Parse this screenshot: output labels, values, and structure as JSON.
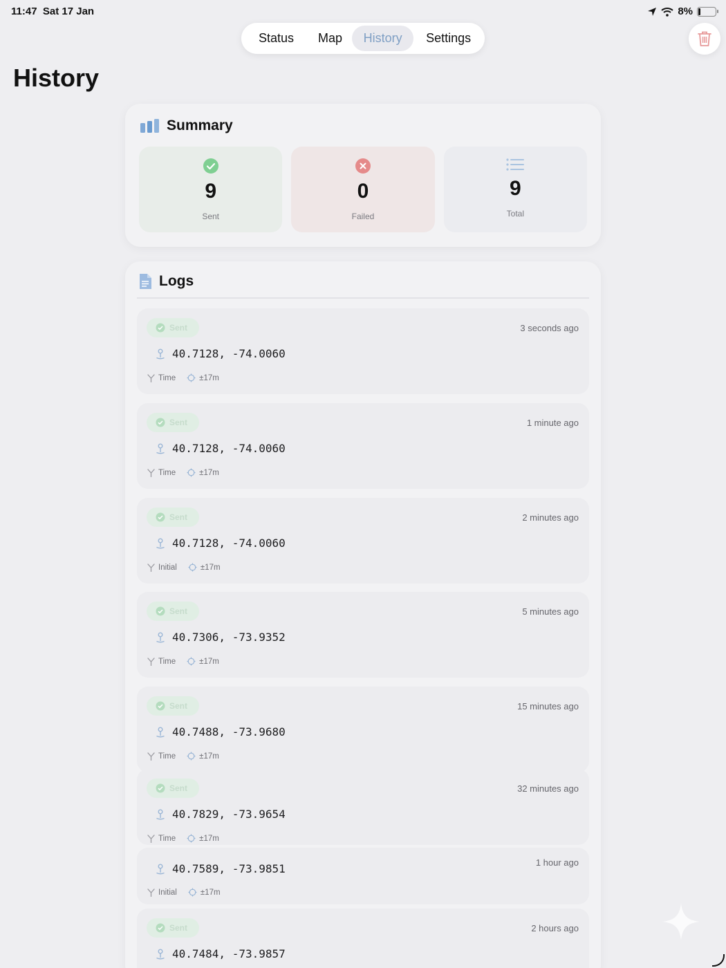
{
  "status_bar": {
    "time": "11:47",
    "date": "Sat 17 Jan",
    "battery": "8%"
  },
  "tabs": [
    {
      "label": "Status"
    },
    {
      "label": "Map"
    },
    {
      "label": "History"
    },
    {
      "label": "Settings"
    }
  ],
  "active_tab": "History",
  "page_title": "History",
  "summary": {
    "title": "Summary",
    "sent": {
      "value": "9",
      "label": "Sent"
    },
    "failed": {
      "value": "0",
      "label": "Failed"
    },
    "total": {
      "value": "9",
      "label": "Total"
    }
  },
  "logs": {
    "title": "Logs",
    "entries": [
      {
        "status": "Sent",
        "ago": "3 seconds ago",
        "coords": "40.7128, -74.0060",
        "trigger": "Time",
        "accuracy": "±17m"
      },
      {
        "status": "Sent",
        "ago": "1 minute ago",
        "coords": "40.7128, -74.0060",
        "trigger": "Time",
        "accuracy": "±17m"
      },
      {
        "status": "Sent",
        "ago": "2 minutes ago",
        "coords": "40.7128, -74.0060",
        "trigger": "Initial",
        "accuracy": "±17m"
      },
      {
        "status": "Sent",
        "ago": "5 minutes ago",
        "coords": "40.7306, -73.9352",
        "trigger": "Time",
        "accuracy": "±17m"
      },
      {
        "status": "Sent",
        "ago": "15 minutes ago",
        "coords": "40.7488, -73.9680",
        "trigger": "Time",
        "accuracy": "±17m"
      },
      {
        "status": "Sent",
        "ago": "32 minutes ago",
        "coords": "40.7829, -73.9654",
        "trigger": "Time",
        "accuracy": "±17m"
      },
      {
        "status": "",
        "ago": "1 hour ago",
        "coords": "40.7589, -73.9851",
        "trigger": "Initial",
        "accuracy": "±17m"
      },
      {
        "status": "Sent",
        "ago": "2 hours ago",
        "coords": "40.7484, -73.9857",
        "trigger": "",
        "accuracy": ""
      }
    ]
  },
  "colors": {
    "accent": "#7f9fc4",
    "sent_green": "#7fcf92",
    "failed_red": "#e58a8a",
    "trash_red": "#e79a9a"
  }
}
